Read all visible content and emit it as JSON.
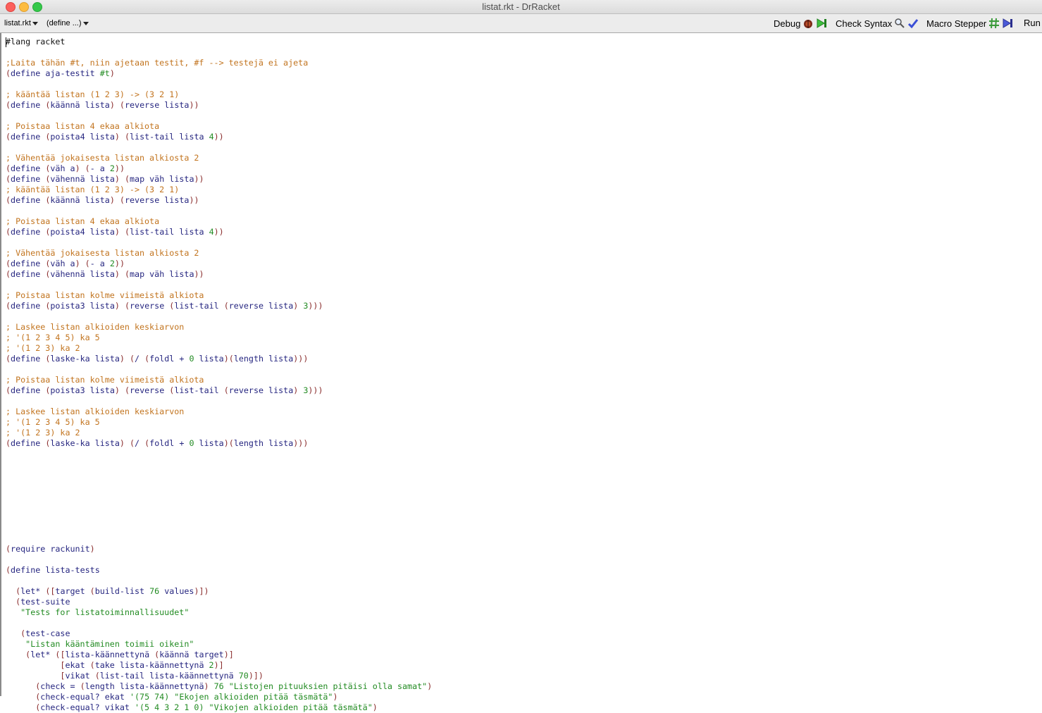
{
  "window": {
    "title": "listat.rkt - DrRacket"
  },
  "toolbar": {
    "file_menu": "listat.rkt",
    "define_menu": "(define ...)",
    "debug_label": "Debug",
    "check_syntax_label": "Check Syntax",
    "macro_stepper_label": "Macro Stepper",
    "run_label": "Run"
  },
  "editor": {
    "lines": [
      [
        [
          "pl",
          "#lang racket"
        ]
      ],
      [],
      [
        [
          "com",
          ";Laita tähän #t, niin ajetaan testit, #f --> testejä ei ajeta"
        ]
      ],
      [
        [
          "par",
          "("
        ],
        [
          "kw",
          "define"
        ],
        [
          "pl",
          " "
        ],
        [
          "sym",
          "aja-testit"
        ],
        [
          "pl",
          " "
        ],
        [
          "num",
          "#t"
        ],
        [
          "par",
          ")"
        ]
      ],
      [],
      [
        [
          "com",
          "; kääntää listan (1 2 3) -> (3 2 1)"
        ]
      ],
      [
        [
          "par",
          "("
        ],
        [
          "kw",
          "define"
        ],
        [
          "pl",
          " "
        ],
        [
          "par",
          "("
        ],
        [
          "sym",
          "käännä lista"
        ],
        [
          "par",
          ")"
        ],
        [
          "pl",
          " "
        ],
        [
          "par",
          "("
        ],
        [
          "sym",
          "reverse lista"
        ],
        [
          "par",
          "))"
        ]
      ],
      [],
      [
        [
          "com",
          "; Poistaa listan 4 ekaa alkiota"
        ]
      ],
      [
        [
          "par",
          "("
        ],
        [
          "kw",
          "define"
        ],
        [
          "pl",
          " "
        ],
        [
          "par",
          "("
        ],
        [
          "sym",
          "poista4 lista"
        ],
        [
          "par",
          ")"
        ],
        [
          "pl",
          " "
        ],
        [
          "par",
          "("
        ],
        [
          "sym",
          "list-tail lista "
        ],
        [
          "num",
          "4"
        ],
        [
          "par",
          "))"
        ]
      ],
      [],
      [
        [
          "com",
          "; Vähentää jokaisesta listan alkiosta 2"
        ]
      ],
      [
        [
          "par",
          "("
        ],
        [
          "kw",
          "define"
        ],
        [
          "pl",
          " "
        ],
        [
          "par",
          "("
        ],
        [
          "sym",
          "väh a"
        ],
        [
          "par",
          ")"
        ],
        [
          "pl",
          " "
        ],
        [
          "par",
          "("
        ],
        [
          "sym",
          "- a "
        ],
        [
          "num",
          "2"
        ],
        [
          "par",
          "))"
        ]
      ],
      [
        [
          "par",
          "("
        ],
        [
          "kw",
          "define"
        ],
        [
          "pl",
          " "
        ],
        [
          "par",
          "("
        ],
        [
          "sym",
          "vähennä lista"
        ],
        [
          "par",
          ")"
        ],
        [
          "pl",
          " "
        ],
        [
          "par",
          "("
        ],
        [
          "sym",
          "map väh lista"
        ],
        [
          "par",
          "))"
        ]
      ],
      [
        [
          "com",
          "; kääntää listan (1 2 3) -> (3 2 1)"
        ]
      ],
      [
        [
          "par",
          "("
        ],
        [
          "kw",
          "define"
        ],
        [
          "pl",
          " "
        ],
        [
          "par",
          "("
        ],
        [
          "sym",
          "käännä lista"
        ],
        [
          "par",
          ")"
        ],
        [
          "pl",
          " "
        ],
        [
          "par",
          "("
        ],
        [
          "sym",
          "reverse lista"
        ],
        [
          "par",
          "))"
        ]
      ],
      [],
      [
        [
          "com",
          "; Poistaa listan 4 ekaa alkiota"
        ]
      ],
      [
        [
          "par",
          "("
        ],
        [
          "kw",
          "define"
        ],
        [
          "pl",
          " "
        ],
        [
          "par",
          "("
        ],
        [
          "sym",
          "poista4 lista"
        ],
        [
          "par",
          ")"
        ],
        [
          "pl",
          " "
        ],
        [
          "par",
          "("
        ],
        [
          "sym",
          "list-tail lista "
        ],
        [
          "num",
          "4"
        ],
        [
          "par",
          "))"
        ]
      ],
      [],
      [
        [
          "com",
          "; Vähentää jokaisesta listan alkiosta 2"
        ]
      ],
      [
        [
          "par",
          "("
        ],
        [
          "kw",
          "define"
        ],
        [
          "pl",
          " "
        ],
        [
          "par",
          "("
        ],
        [
          "sym",
          "väh a"
        ],
        [
          "par",
          ")"
        ],
        [
          "pl",
          " "
        ],
        [
          "par",
          "("
        ],
        [
          "sym",
          "- a "
        ],
        [
          "num",
          "2"
        ],
        [
          "par",
          "))"
        ]
      ],
      [
        [
          "par",
          "("
        ],
        [
          "kw",
          "define"
        ],
        [
          "pl",
          " "
        ],
        [
          "par",
          "("
        ],
        [
          "sym",
          "vähennä lista"
        ],
        [
          "par",
          ")"
        ],
        [
          "pl",
          " "
        ],
        [
          "par",
          "("
        ],
        [
          "sym",
          "map väh lista"
        ],
        [
          "par",
          "))"
        ]
      ],
      [],
      [
        [
          "com",
          "; Poistaa listan kolme viimeistä alkiota"
        ]
      ],
      [
        [
          "par",
          "("
        ],
        [
          "kw",
          "define"
        ],
        [
          "pl",
          " "
        ],
        [
          "par",
          "("
        ],
        [
          "sym",
          "poista3 lista"
        ],
        [
          "par",
          ")"
        ],
        [
          "pl",
          " "
        ],
        [
          "par",
          "("
        ],
        [
          "sym",
          "reverse "
        ],
        [
          "par",
          "("
        ],
        [
          "sym",
          "list-tail "
        ],
        [
          "par",
          "("
        ],
        [
          "sym",
          "reverse lista"
        ],
        [
          "par",
          ")"
        ],
        [
          "pl",
          " "
        ],
        [
          "num",
          "3"
        ],
        [
          "par",
          ")))"
        ]
      ],
      [],
      [
        [
          "com",
          "; Laskee listan alkioiden keskiarvon"
        ]
      ],
      [
        [
          "com",
          "; '(1 2 3 4 5) ka 5"
        ]
      ],
      [
        [
          "com",
          "; '(1 2 3) ka 2"
        ]
      ],
      [
        [
          "par",
          "("
        ],
        [
          "kw",
          "define"
        ],
        [
          "pl",
          " "
        ],
        [
          "par",
          "("
        ],
        [
          "sym",
          "laske-ka lista"
        ],
        [
          "par",
          ")"
        ],
        [
          "pl",
          " "
        ],
        [
          "par",
          "("
        ],
        [
          "sym",
          "/ "
        ],
        [
          "par",
          "("
        ],
        [
          "sym",
          "foldl + "
        ],
        [
          "num",
          "0"
        ],
        [
          "sym",
          " lista"
        ],
        [
          "par",
          ")("
        ],
        [
          "sym",
          "length lista"
        ],
        [
          "par",
          ")))"
        ]
      ],
      [],
      [
        [
          "com",
          "; Poistaa listan kolme viimeistä alkiota"
        ]
      ],
      [
        [
          "par",
          "("
        ],
        [
          "kw",
          "define"
        ],
        [
          "pl",
          " "
        ],
        [
          "par",
          "("
        ],
        [
          "sym",
          "poista3 lista"
        ],
        [
          "par",
          ")"
        ],
        [
          "pl",
          " "
        ],
        [
          "par",
          "("
        ],
        [
          "sym",
          "reverse "
        ],
        [
          "par",
          "("
        ],
        [
          "sym",
          "list-tail "
        ],
        [
          "par",
          "("
        ],
        [
          "sym",
          "reverse lista"
        ],
        [
          "par",
          ")"
        ],
        [
          "pl",
          " "
        ],
        [
          "num",
          "3"
        ],
        [
          "par",
          ")))"
        ]
      ],
      [],
      [
        [
          "com",
          "; Laskee listan alkioiden keskiarvon"
        ]
      ],
      [
        [
          "com",
          "; '(1 2 3 4 5) ka 5"
        ]
      ],
      [
        [
          "com",
          "; '(1 2 3) ka 2"
        ]
      ],
      [
        [
          "par",
          "("
        ],
        [
          "kw",
          "define"
        ],
        [
          "pl",
          " "
        ],
        [
          "par",
          "("
        ],
        [
          "sym",
          "laske-ka lista"
        ],
        [
          "par",
          ")"
        ],
        [
          "pl",
          " "
        ],
        [
          "par",
          "("
        ],
        [
          "sym",
          "/ "
        ],
        [
          "par",
          "("
        ],
        [
          "sym",
          "foldl + "
        ],
        [
          "num",
          "0"
        ],
        [
          "sym",
          " lista"
        ],
        [
          "par",
          ")("
        ],
        [
          "sym",
          "length lista"
        ],
        [
          "par",
          ")))"
        ]
      ],
      [],
      [],
      [],
      [],
      [],
      [],
      [],
      [],
      [],
      [
        [
          "par",
          "("
        ],
        [
          "kw",
          "require"
        ],
        [
          "pl",
          " "
        ],
        [
          "sym",
          "rackunit"
        ],
        [
          "par",
          ")"
        ]
      ],
      [],
      [
        [
          "par",
          "("
        ],
        [
          "kw",
          "define"
        ],
        [
          "pl",
          " "
        ],
        [
          "sym",
          "lista-tests"
        ]
      ],
      [],
      [
        [
          "pl",
          "  "
        ],
        [
          "par",
          "("
        ],
        [
          "kw",
          "let*"
        ],
        [
          "pl",
          " "
        ],
        [
          "par",
          "(["
        ],
        [
          "sym",
          "target "
        ],
        [
          "par",
          "("
        ],
        [
          "sym",
          "build-list "
        ],
        [
          "num",
          "76"
        ],
        [
          "sym",
          " values"
        ],
        [
          "par",
          ")])"
        ]
      ],
      [
        [
          "pl",
          "  "
        ],
        [
          "par",
          "("
        ],
        [
          "sym",
          "test-suite"
        ]
      ],
      [
        [
          "pl",
          "   "
        ],
        [
          "str",
          "\"Tests for listatoiminnallisuudet\""
        ]
      ],
      [],
      [
        [
          "pl",
          "   "
        ],
        [
          "par",
          "("
        ],
        [
          "sym",
          "test-case"
        ]
      ],
      [
        [
          "pl",
          "    "
        ],
        [
          "str",
          "\"Listan kääntäminen toimii oikein\""
        ]
      ],
      [
        [
          "pl",
          "    "
        ],
        [
          "par",
          "("
        ],
        [
          "kw",
          "let*"
        ],
        [
          "pl",
          " "
        ],
        [
          "par",
          "(["
        ],
        [
          "sym",
          "lista-käännettynä "
        ],
        [
          "par",
          "("
        ],
        [
          "sym",
          "käännä target"
        ],
        [
          "par",
          ")]"
        ]
      ],
      [
        [
          "pl",
          "           "
        ],
        [
          "par",
          "["
        ],
        [
          "sym",
          "ekat "
        ],
        [
          "par",
          "("
        ],
        [
          "sym",
          "take lista-käännettynä "
        ],
        [
          "num",
          "2"
        ],
        [
          "par",
          ")]"
        ]
      ],
      [
        [
          "pl",
          "           "
        ],
        [
          "par",
          "["
        ],
        [
          "sym",
          "vikat "
        ],
        [
          "par",
          "("
        ],
        [
          "sym",
          "list-tail lista-käännettynä "
        ],
        [
          "num",
          "70"
        ],
        [
          "par",
          ")])"
        ]
      ],
      [
        [
          "pl",
          "      "
        ],
        [
          "par",
          "("
        ],
        [
          "sym",
          "check = "
        ],
        [
          "par",
          "("
        ],
        [
          "sym",
          "length lista-käännettynä"
        ],
        [
          "par",
          ")"
        ],
        [
          "pl",
          " "
        ],
        [
          "num",
          "76"
        ],
        [
          "pl",
          " "
        ],
        [
          "str",
          "\"Listojen pituuksien pitäisi olla samat\""
        ],
        [
          "par",
          ")"
        ]
      ],
      [
        [
          "pl",
          "      "
        ],
        [
          "par",
          "("
        ],
        [
          "sym",
          "check-equal? ekat "
        ],
        [
          "num",
          "'(75 74)"
        ],
        [
          "pl",
          " "
        ],
        [
          "str",
          "\"Ekojen alkioiden pitää täsmätä\""
        ],
        [
          "par",
          ")"
        ]
      ],
      [
        [
          "pl",
          "      "
        ],
        [
          "par",
          "("
        ],
        [
          "sym",
          "check-equal? vikat "
        ],
        [
          "num",
          "'(5 4 3 2 1 0)"
        ],
        [
          "pl",
          " "
        ],
        [
          "str",
          "\"Vikojen alkioiden pitää täsmätä\""
        ],
        [
          "par",
          ")"
        ]
      ]
    ]
  }
}
